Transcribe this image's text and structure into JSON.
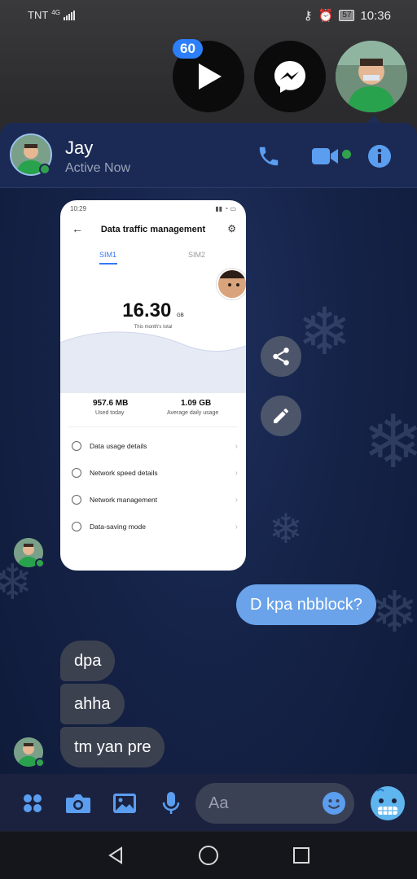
{
  "status_bar": {
    "carrier": "TNT",
    "network": "4G",
    "time": "10:36",
    "battery": "57"
  },
  "chat_heads": {
    "badge_count": "60"
  },
  "chat_header": {
    "name": "Jay",
    "status": "Active Now"
  },
  "shared_image": {
    "time": "10:29",
    "title": "Data traffic management",
    "tabs": [
      "SIM1",
      "SIM2"
    ],
    "total_value": "16.30",
    "total_unit": "GB",
    "total_label": "This month's total",
    "used_today_value": "957.6 MB",
    "used_today_label": "Used today",
    "avg_daily_value": "1.09 GB",
    "avg_daily_label": "Average daily usage",
    "menu": [
      "Data usage details",
      "Network speed details",
      "Network management",
      "Data-saving mode"
    ]
  },
  "messages": {
    "outgoing": [
      "D kpa nbblock?"
    ],
    "incoming": [
      "dpa",
      "ahha",
      "tm yan pre"
    ]
  },
  "composer": {
    "placeholder": "Aa"
  },
  "colors": {
    "accent": "#4a90e2",
    "outgoing_bubble": "#6aa3ea",
    "incoming_bubble": "#3c4150",
    "online": "#31a24c"
  }
}
